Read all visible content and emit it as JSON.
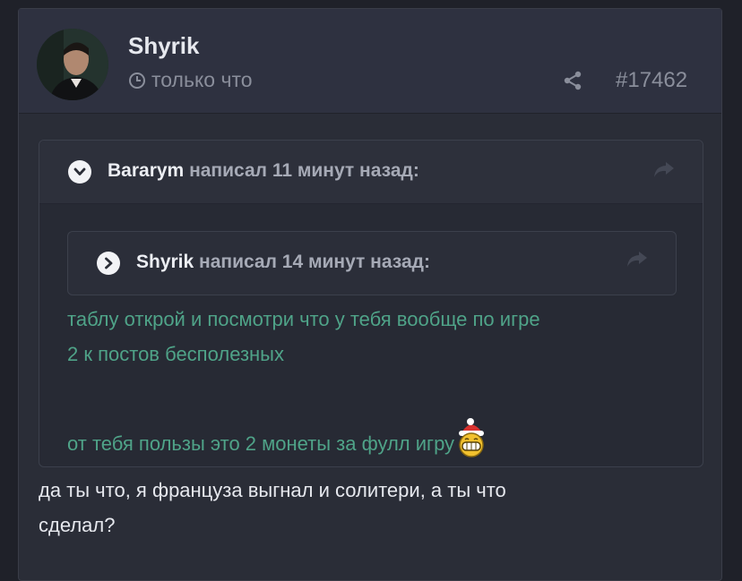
{
  "post": {
    "author": "Shyrik",
    "time": "только что",
    "number": "#17462",
    "body_lines": [
      "да ты что, я француза выгнал и солитери, а ты что",
      "сделал?"
    ]
  },
  "quote_outer": {
    "author": "Bararym",
    "meta": " написал 11 минут назад:"
  },
  "quote_inner": {
    "author": "Shyrik",
    "meta": " написал 14 минут назад:"
  },
  "quote_text": {
    "line1": "таблу открой и посмотри что у тебя вообще по игре",
    "line2": "2 к постов бесполезных",
    "line3": "от тебя пользы это 2 монеты за фулл игру"
  },
  "icons": {
    "clock": "clock-icon",
    "share": "share-icon",
    "expand": "chevron-down-icon",
    "collapse": "chevron-right-icon",
    "reply": "reply-arrow-icon",
    "emoji": "grin-santa-emoji-icon"
  },
  "colors": {
    "background": "#1f2129",
    "panel": "#2a2d37",
    "quote_text": "#4fa388",
    "text": "#e6e8ee",
    "muted": "#8a8e9b"
  }
}
